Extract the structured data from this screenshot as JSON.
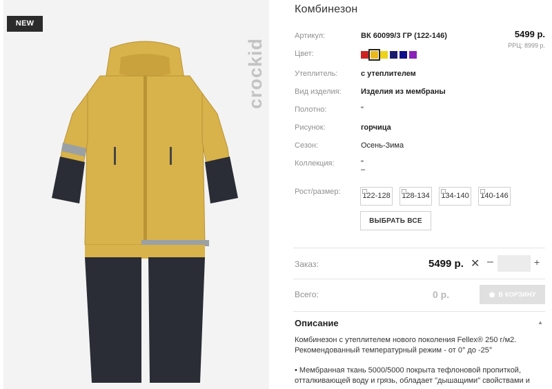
{
  "badge": "NEW",
  "brand": "crockid",
  "product": {
    "title": "Комбинезон",
    "price": "5499 р.",
    "rrp": "РРЦ: 8999 р.",
    "attrs": [
      {
        "key": "Артикул:",
        "value": "ВК 60099/3 ГР (122-146)",
        "bold": true
      },
      {
        "key": "Цвет:",
        "value": ""
      },
      {
        "key": "Утеплитель:",
        "value": "с утеплителем",
        "bold": true
      },
      {
        "key": "Вид изделия:",
        "value": "Изделия из мембраны",
        "bold": true
      },
      {
        "key": "Полотно:",
        "value": "\""
      },
      {
        "key": "Рисунок:",
        "value": "горчица",
        "bold": true
      },
      {
        "key": "Сезон:",
        "value": "Осень-Зима"
      },
      {
        "key": "Коллекция:",
        "value": "\""
      },
      {
        "key": "Рост/размер:",
        "value": ""
      }
    ],
    "collection_dash": "–",
    "colors": [
      "#cc2222",
      "#e8b81c",
      "#ecd21a",
      "#1b1b6e",
      "#0e0e8a",
      "#8a22b8"
    ],
    "selected_color_index": 1,
    "sizes": [
      "122-128",
      "128-134",
      "134-140",
      "140-146"
    ],
    "select_all": "ВЫБРАТЬ ВСЕ"
  },
  "order": {
    "label": "Заказ:",
    "price": "5499 р.",
    "times": "✕",
    "minus": "–",
    "qty": "",
    "plus": "+"
  },
  "total": {
    "label": "Всего:",
    "value": "0 р.",
    "cart_button": "В КОРЗИНУ"
  },
  "description": {
    "heading": "Описание",
    "caret": "▲",
    "lines": [
      "Комбинезон с утеплителем нового поколения Fellex® 250 г/м2.",
      "Рекомендованный температурный режим - от 0° до -25°",
      "• Мембранная ткань 5000/5000 покрыта тефлоновой пропиткой,",
      "отталкивающей воду и грязь, обладает \"дышащими\" свойствами и"
    ]
  },
  "colors_ui": {
    "suit_yellow": "#d8b24a",
    "suit_dark": "#2a2d36",
    "reflective": "#9aa0a4"
  }
}
